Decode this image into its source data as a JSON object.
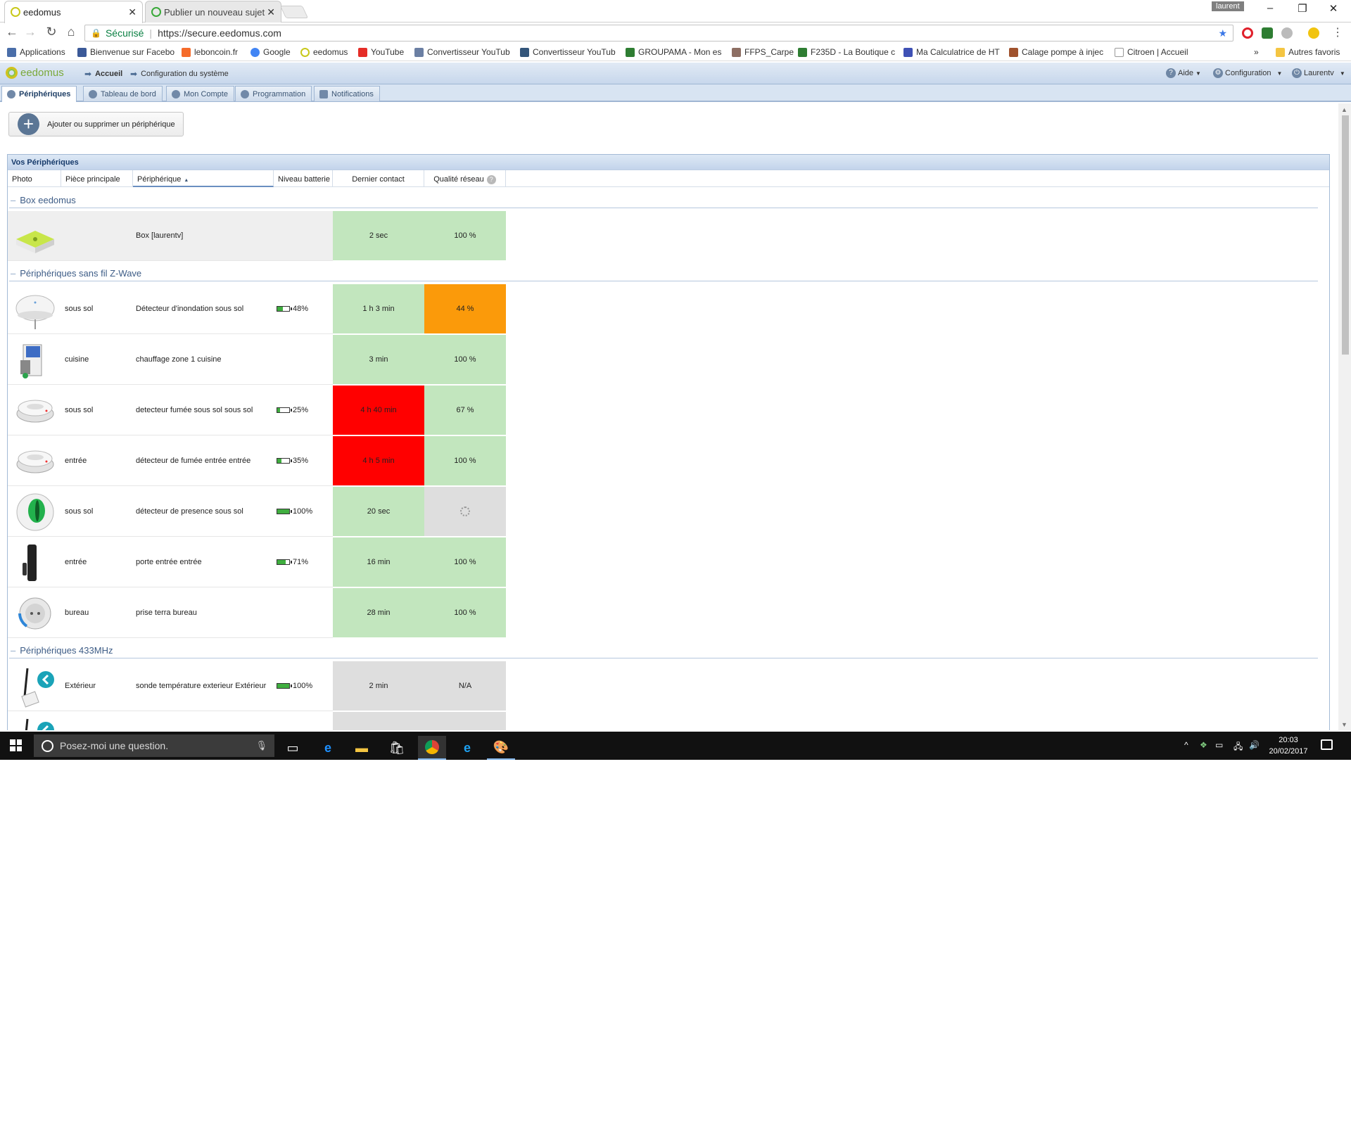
{
  "browser": {
    "tabs": [
      {
        "title": "eedomus",
        "active": true
      },
      {
        "title": "Publier un nouveau sujet",
        "active": false
      }
    ],
    "os_user": "laurent",
    "window_controls": [
      "–",
      "❐",
      "✕"
    ],
    "security_label": "Sécurisé",
    "url": "https://secure.eedomus.com",
    "bookmarks": [
      {
        "label": "Applications",
        "icon": "apps-grid-icon",
        "color": "#4a6ea9"
      },
      {
        "label": "Bienvenue sur Facebo",
        "icon": "facebook-icon",
        "color": "#3b5998"
      },
      {
        "label": "leboncoin.fr",
        "icon": "leboncoin-icon",
        "color": "#f56b2a"
      },
      {
        "label": "Google",
        "icon": "google-icon",
        "color": "#4285f4"
      },
      {
        "label": "eedomus",
        "icon": "eedomus-icon",
        "color": "#c8c81a"
      },
      {
        "label": "YouTube",
        "icon": "youtube-icon",
        "color": "#e52d27"
      },
      {
        "label": "Convertisseur YouTub",
        "icon": "converter-icon",
        "color": "#6b7fa3"
      },
      {
        "label": "Convertisseur YouTub",
        "icon": "converter-icon",
        "color": "#33557a"
      },
      {
        "label": "GROUPAMA - Mon es",
        "icon": "groupama-icon",
        "color": "#2e7d32"
      },
      {
        "label": "FFPS_Carpe",
        "icon": "ffps-icon",
        "color": "#8d6e63"
      },
      {
        "label": "F235D - La Boutique c",
        "icon": "boutique-icon",
        "color": "#2e7d32"
      },
      {
        "label": "Ma Calculatrice de HT",
        "icon": "calculator-icon",
        "color": "#3f51b5"
      },
      {
        "label": "Calage pompe à injec",
        "icon": "car-icon",
        "color": "#a0522d"
      },
      {
        "label": "Citroen | Accueil",
        "icon": "page-icon",
        "color": "#999999"
      }
    ],
    "more_bookmarks": "»",
    "other_bookmarks": "Autres favoris"
  },
  "app": {
    "brand": "eedomus",
    "breadcrumb": [
      "Accueil",
      "Configuration du système"
    ],
    "header_right": {
      "help": "Aide",
      "config": "Configuration",
      "user": "Laurentv"
    },
    "tabs": [
      "Périphériques",
      "Tableau de bord",
      "Mon Compte",
      "Programmation",
      "Notifications"
    ],
    "add_button": "Ajouter ou supprimer un périphérique",
    "panel_title": "Vos Périphériques",
    "columns": [
      "Photo",
      "Pièce principale",
      "Périphérique",
      "Niveau batterie",
      "Dernier contact",
      "Qualité réseau"
    ],
    "groups": [
      {
        "title": "Box eedomus",
        "rows": [
          {
            "photo": "box-icon",
            "room": "",
            "name": "Box [laurentv]",
            "battery": "",
            "battery_level": null,
            "contact": "2 sec",
            "contact_color": "#c2e6be",
            "network": "100 %",
            "network_color": "#c2e6be"
          }
        ]
      },
      {
        "title": "Périphériques sans fil Z-Wave",
        "rows": [
          {
            "photo": "flood-sensor-icon",
            "room": "sous sol",
            "name": "Détecteur d'inondation sous sol",
            "battery": "48%",
            "battery_level": 0.48,
            "contact": "1 h 3 min",
            "contact_color": "#c2e6be",
            "network": "44 %",
            "network_color": "#fb9a0a"
          },
          {
            "photo": "relay-module-icon",
            "room": "cuisine",
            "name": "chauffage zone 1 cuisine",
            "battery": "",
            "battery_level": null,
            "contact": "3 min",
            "contact_color": "#c2e6be",
            "network": "100 %",
            "network_color": "#c2e6be"
          },
          {
            "photo": "smoke-detector-icon",
            "room": "sous sol",
            "name": "detecteur fumée sous sol sous sol",
            "battery": "25%",
            "battery_level": 0.25,
            "contact": "4 h 40 min",
            "contact_color": "#ff0000",
            "network": "67 %",
            "network_color": "#c2e6be"
          },
          {
            "photo": "smoke-detector-icon",
            "room": "entrée",
            "name": "détecteur de fumée entrée entrée",
            "battery": "35%",
            "battery_level": 0.35,
            "contact": "4 h 5 min",
            "contact_color": "#ff0000",
            "network": "100 %",
            "network_color": "#c2e6be"
          },
          {
            "photo": "motion-sensor-icon",
            "room": "sous sol",
            "name": "détecteur de presence sous sol",
            "battery": "100%",
            "battery_level": 1.0,
            "contact": "20 sec",
            "contact_color": "#c2e6be",
            "network": "",
            "network_color": "#dedede",
            "network_loading": true
          },
          {
            "photo": "door-sensor-icon",
            "room": "entrée",
            "name": "porte entrée entrée",
            "battery": "71%",
            "battery_level": 0.71,
            "contact": "16 min",
            "contact_color": "#c2e6be",
            "network": "100 %",
            "network_color": "#c2e6be"
          },
          {
            "photo": "smart-plug-icon",
            "room": "bureau",
            "name": "prise terra bureau",
            "battery": "",
            "battery_level": null,
            "contact": "28 min",
            "contact_color": "#c2e6be",
            "network": "100 %",
            "network_color": "#c2e6be"
          }
        ]
      },
      {
        "title": "Périphériques 433MHz",
        "rows": [
          {
            "photo": "rf-probe-icon",
            "room": "Extérieur",
            "name": "sonde température exterieur Extérieur",
            "battery": "100%",
            "battery_level": 1.0,
            "contact": "2 min",
            "contact_color": "#dedede",
            "network": "N/A",
            "network_color": "#dedede"
          },
          {
            "photo": "rf-probe-icon",
            "room": "",
            "name": "",
            "battery": "",
            "battery_level": null,
            "contact": "",
            "contact_color": "#dedede",
            "network": "",
            "network_color": "#dedede"
          }
        ]
      }
    ]
  },
  "taskbar": {
    "search_placeholder": "Posez-moi une question.",
    "time": "20:03",
    "date": "20/02/2017"
  }
}
